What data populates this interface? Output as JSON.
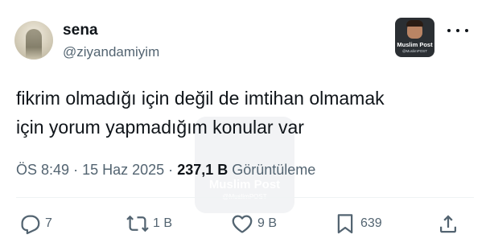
{
  "user": {
    "display_name": "sena",
    "handle": "@ziyandamiyim"
  },
  "badge": {
    "title": "Muslim Post",
    "subtitle": "@MuslimPOST"
  },
  "tweet": {
    "lines": [
      "fikrim olmadığı için değil de imtihan olmamak",
      "için yorum yapmadığım konular var"
    ]
  },
  "watermark": {
    "title": "Muslim Post",
    "subtitle": "@MuslimPOST"
  },
  "meta": {
    "time": "ÖS 8:49",
    "separator": "·",
    "date": "15 Haz 2025",
    "views_count": "237,1 B",
    "views_label": "Görüntüleme"
  },
  "actions": {
    "replies": "7",
    "reposts": "1 B",
    "likes": "9 B",
    "bookmarks": "639"
  },
  "icons": {
    "more": "more-icon",
    "reply": "reply-icon",
    "repost": "repost-icon",
    "like": "heart-icon",
    "bookmark": "bookmark-icon",
    "share": "share-icon"
  },
  "colors": {
    "text": "#0f1419",
    "secondary": "#536471",
    "background": "#ffffff"
  }
}
